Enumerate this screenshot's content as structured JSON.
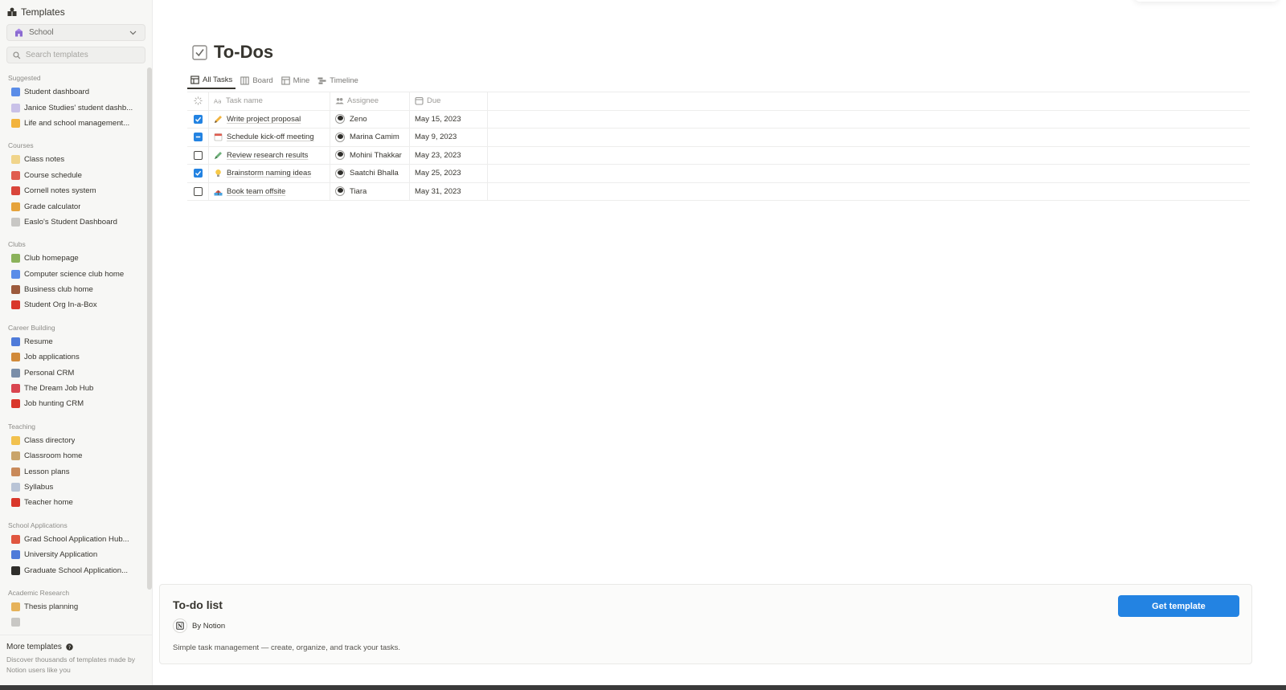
{
  "sidebar": {
    "header": "Templates",
    "category_select": "School",
    "search_placeholder": "Search templates",
    "sections": [
      {
        "title": "Suggested",
        "items": [
          {
            "label": "Student dashboard",
            "icon": "student-dashboard-icon"
          },
          {
            "label": "Janice Studies' student dashb...",
            "icon": "notebook-icon"
          },
          {
            "label": "Life and school management...",
            "icon": "cat-face-icon"
          }
        ]
      },
      {
        "title": "Courses",
        "items": [
          {
            "label": "Class notes",
            "icon": "memo-icon"
          },
          {
            "label": "Course schedule",
            "icon": "calendar-icon"
          },
          {
            "label": "Cornell notes system",
            "icon": "pushpin-icon"
          },
          {
            "label": "Grade calculator",
            "icon": "abacus-icon"
          },
          {
            "label": "Easlo's Student Dashboard",
            "icon": "page-icon"
          }
        ]
      },
      {
        "title": "Clubs",
        "items": [
          {
            "label": "Club homepage",
            "icon": "house-icon"
          },
          {
            "label": "Computer science club home",
            "icon": "laptop-icon"
          },
          {
            "label": "Business club home",
            "icon": "briefcase-icon"
          },
          {
            "label": "Student Org In-a-Box",
            "icon": "apple-icon"
          }
        ]
      },
      {
        "title": "Career Building",
        "items": [
          {
            "label": "Resume",
            "icon": "profile-icon"
          },
          {
            "label": "Job applications",
            "icon": "inbox-icon"
          },
          {
            "label": "Personal CRM",
            "icon": "contact-icon"
          },
          {
            "label": "The Dream Job Hub",
            "icon": "chart-up-icon"
          },
          {
            "label": "Job hunting CRM",
            "icon": "target-icon"
          }
        ]
      },
      {
        "title": "Teaching",
        "items": [
          {
            "label": "Class directory",
            "icon": "hand-icon"
          },
          {
            "label": "Classroom home",
            "icon": "school-icon"
          },
          {
            "label": "Lesson plans",
            "icon": "clipboard-icon"
          },
          {
            "label": "Syllabus",
            "icon": "document-icon"
          },
          {
            "label": "Teacher home",
            "icon": "apple-icon"
          }
        ]
      },
      {
        "title": "School Applications",
        "items": [
          {
            "label": "Grad School Application Hub...",
            "icon": "gift-icon"
          },
          {
            "label": "University Application",
            "icon": "ledger-icon"
          },
          {
            "label": "Graduate School Application...",
            "icon": "graduation-cap-icon"
          }
        ]
      },
      {
        "title": "Academic Research",
        "items": [
          {
            "label": "Thesis planning",
            "icon": "scroll-icon"
          },
          {
            "label": "",
            "icon": "page-icon"
          }
        ]
      }
    ],
    "footer_title": "More templates",
    "footer_desc": "Discover thousands of templates made by Notion users like you"
  },
  "main": {
    "title": "To-Dos",
    "views": [
      {
        "label": "All Tasks",
        "icon": "table-icon",
        "active": true
      },
      {
        "label": "Board",
        "icon": "board-icon",
        "active": false
      },
      {
        "label": "Mine",
        "icon": "table-icon",
        "active": false
      },
      {
        "label": "Timeline",
        "icon": "timeline-icon",
        "active": false
      }
    ],
    "table": {
      "headers": {
        "task": "Task name",
        "assignee": "Assignee",
        "due": "Due"
      },
      "rows": [
        {
          "checked": "checked",
          "emoji": "pencil-icon",
          "task": "Write project proposal",
          "assignee": "Zeno",
          "due": "May 15, 2023"
        },
        {
          "checked": "indeterminate",
          "emoji": "calendar-icon",
          "task": "Schedule kick-off meeting",
          "assignee": "Marina Camim",
          "due": "May 9, 2023"
        },
        {
          "checked": "unchecked",
          "emoji": "crayon-icon",
          "task": "Review research results",
          "assignee": "Mohini Thakkar",
          "due": "May 23, 2023"
        },
        {
          "checked": "checked",
          "emoji": "lightbulb-icon",
          "task": "Brainstorm naming ideas",
          "assignee": "Saatchi Bhalla",
          "due": "May 25, 2023"
        },
        {
          "checked": "unchecked",
          "emoji": "beach-icon",
          "task": "Book team offsite",
          "assignee": "Tiara",
          "due": "May 31, 2023"
        }
      ]
    }
  },
  "card": {
    "title": "To-do list",
    "author": "By Notion",
    "description": "Simple task management — create, organize, and track your tasks.",
    "button": "Get template"
  },
  "colors": {
    "accent": "#2383e2",
    "sidebar_bg": "#f7f7f5",
    "text": "#37352f"
  }
}
